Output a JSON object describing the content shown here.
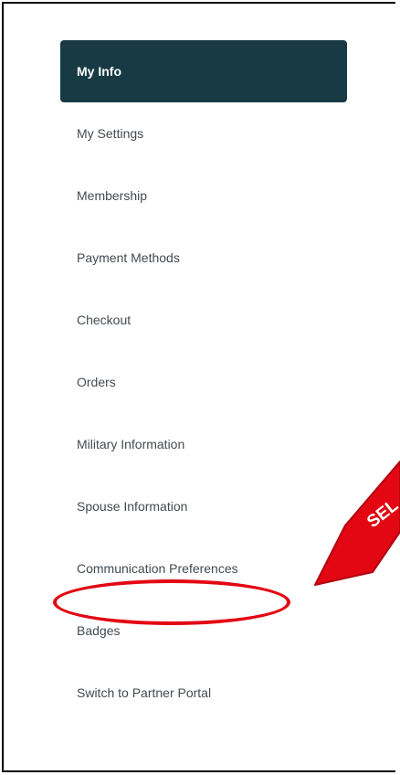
{
  "sidebar": {
    "items": [
      {
        "label": "My Info"
      },
      {
        "label": "My Settings"
      },
      {
        "label": "Membership"
      },
      {
        "label": "Payment Methods"
      },
      {
        "label": "Checkout"
      },
      {
        "label": "Orders"
      },
      {
        "label": "Military Information"
      },
      {
        "label": "Spouse Information"
      },
      {
        "label": "Communication Preferences"
      },
      {
        "label": "Badges"
      },
      {
        "label": "Switch to Partner Portal"
      }
    ],
    "active_index": 0
  },
  "annotation": {
    "arrow_text": "SEL",
    "color": "#e30613"
  },
  "colors": {
    "active_bg": "#173a44",
    "text": "#444a50"
  }
}
